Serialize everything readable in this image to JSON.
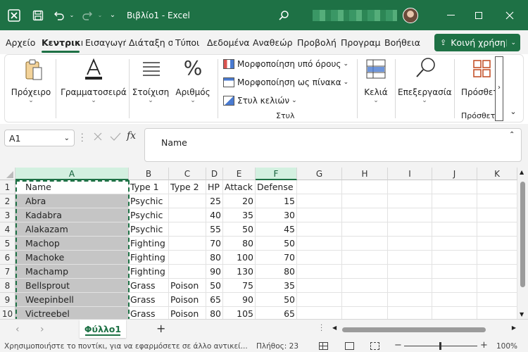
{
  "titlebar": {
    "title": "Βιβλίο1 - Excel"
  },
  "ribbon_tabs": [
    "Αρχείο",
    "Κεντρική",
    "Εισαγωγή",
    "Διάταξη σ",
    "Τύποι",
    "Δεδομένα",
    "Αναθεώρ",
    "Προβολή",
    "Προγραμ",
    "Βοήθεια"
  ],
  "share_label": "Κοινή χρήση",
  "ribbon": {
    "clipboard": "Πρόχειρο",
    "font": "Γραμματοσειρά",
    "alignment": "Στοίχιση",
    "number": "Αριθμός",
    "conditional": "Μορφοποίηση υπό όρους",
    "as_table": "Μορφοποίηση ως πίνακα",
    "cell_styles": "Στυλ κελιών",
    "styles_group": "Στυλ",
    "cells": "Κελιά",
    "editing": "Επεξεργασία",
    "addins": "Πρόσθετ",
    "addins_group": "Πρόσθετ"
  },
  "formula": {
    "namebox": "A1",
    "fx_label": "fx",
    "content": "Name"
  },
  "columns": [
    "A",
    "B",
    "C",
    "D",
    "E",
    "F",
    "G",
    "H",
    "I",
    "J",
    "K"
  ],
  "rows": [
    [
      "Name",
      "Type 1",
      "Type 2",
      "HP",
      "Attack",
      "Defense"
    ],
    [
      "Abra",
      "Psychic",
      "",
      "25",
      "20",
      "15"
    ],
    [
      "Kadabra",
      "Psychic",
      "",
      "40",
      "35",
      "30"
    ],
    [
      "Alakazam",
      "Psychic",
      "",
      "55",
      "50",
      "45"
    ],
    [
      "Machop",
      "Fighting",
      "",
      "70",
      "80",
      "50"
    ],
    [
      "Machoke",
      "Fighting",
      "",
      "80",
      "100",
      "70"
    ],
    [
      "Machamp",
      "Fighting",
      "",
      "90",
      "130",
      "80"
    ],
    [
      "Bellsprout",
      "Grass",
      "Poison",
      "50",
      "75",
      "35"
    ],
    [
      "Weepinbell",
      "Grass",
      "Poison",
      "65",
      "90",
      "50"
    ],
    [
      "Victreebel",
      "Grass",
      "Poison",
      "80",
      "105",
      "65"
    ]
  ],
  "row_numbers": [
    "1",
    "2",
    "3",
    "4",
    "5",
    "6",
    "7",
    "8",
    "9",
    "10"
  ],
  "sheet_tab": "Φύλλο1",
  "add_sheet": "+",
  "status": {
    "message": "Χρησιμοποιήστε το ποντίκι, για να εφαρμόσετε σε άλλο αντικεί...",
    "count": "Πλήθος: 23",
    "zoom": "100%"
  },
  "colors": {
    "accent": "#1e7145",
    "selection": "#c5c5c5"
  }
}
